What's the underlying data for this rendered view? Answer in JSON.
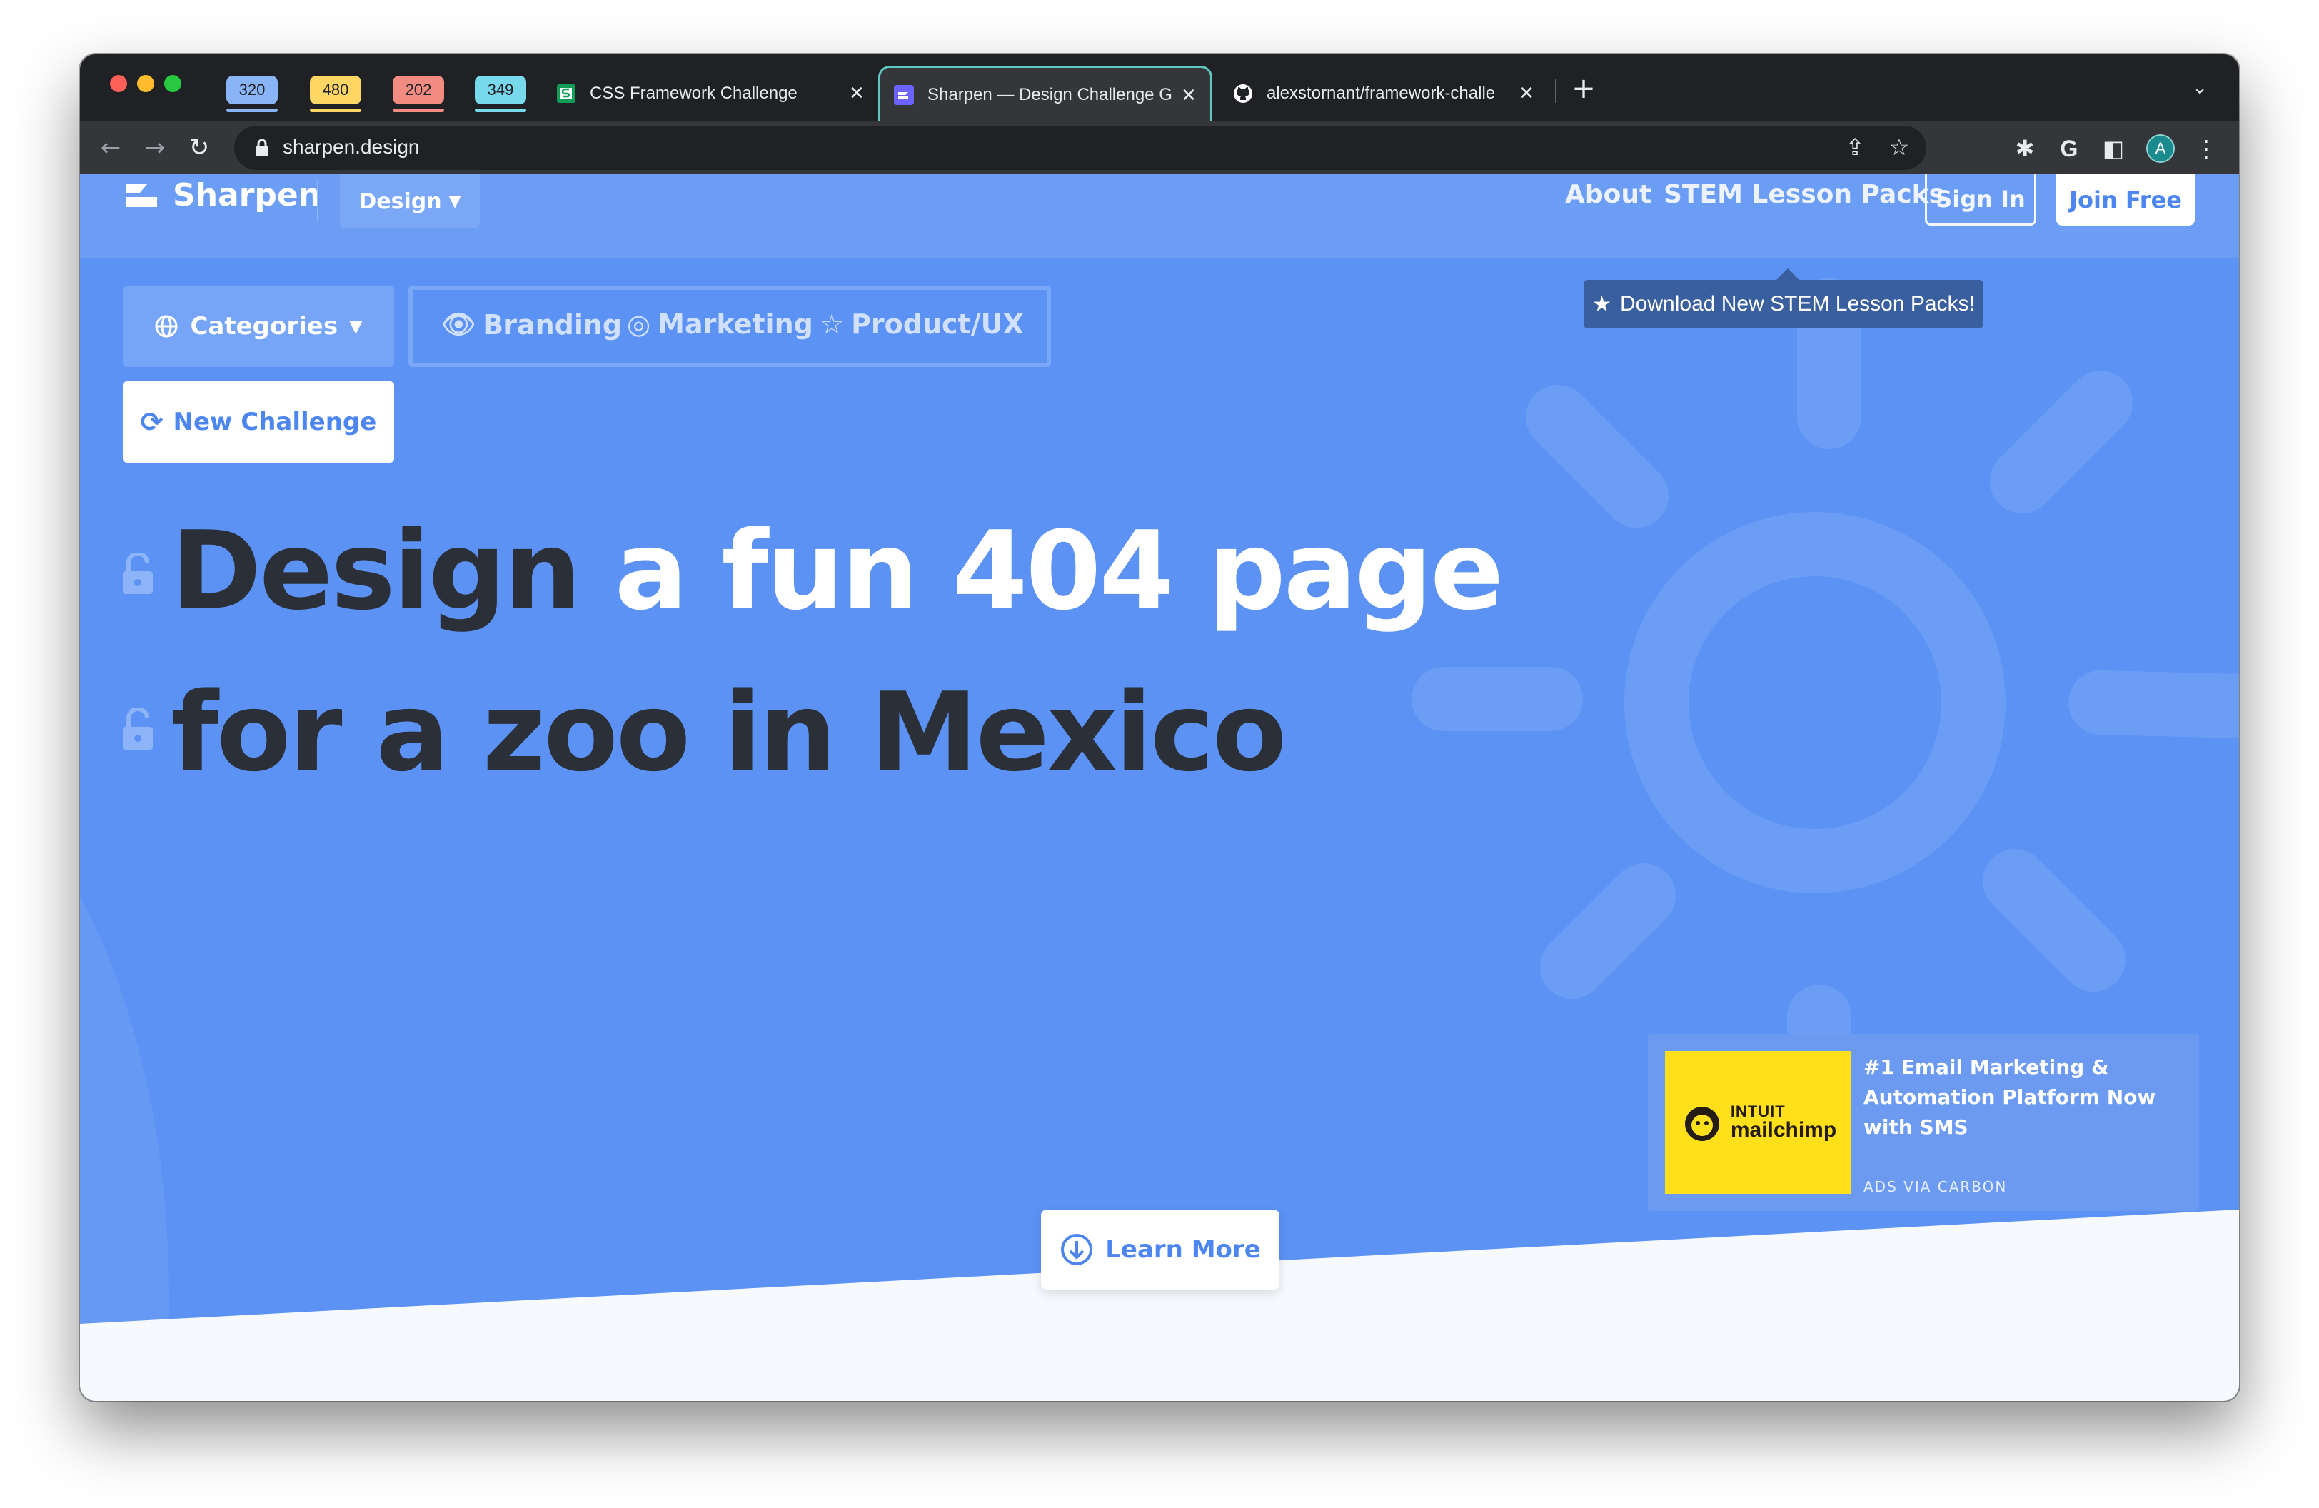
{
  "browser": {
    "tab_groups": [
      {
        "label": "320",
        "color": "#8ab4f8"
      },
      {
        "label": "480",
        "color": "#fdd663"
      },
      {
        "label": "202",
        "color": "#f28b82"
      },
      {
        "label": "349",
        "color": "#78d9ec"
      }
    ],
    "tabs": [
      {
        "title": "CSS Framework Challenge",
        "active": false
      },
      {
        "title": "Sharpen — Design Challenge G",
        "active": true
      },
      {
        "title": "alexstornant/framework-challe",
        "active": false
      }
    ],
    "new_tab_label": "+",
    "url": "sharpen.design",
    "profile_initial": "A"
  },
  "site": {
    "logo_text": "Sharpen",
    "category_dropdown": "Design",
    "nav": {
      "about": "About",
      "stem": "STEM Lesson Packs",
      "signin": "Sign In",
      "joinfree": "Join Free"
    },
    "tooltip": "Download New STEM Lesson Packs!",
    "categories_label": "Categories",
    "category_links": [
      "Branding",
      "Marketing",
      "Product/UX"
    ],
    "new_challenge_label": "New Challenge",
    "headline": {
      "line1_dark": "Design",
      "line1_light": "a fun 404 page",
      "line2": "for a zoo in Mexico"
    },
    "ad": {
      "brand_top": "INTUIT",
      "brand_bottom": "mailchimp",
      "text": "#1 Email Marketing & Automation Platform Now with SMS",
      "via": "ADS VIA CARBON"
    },
    "learn_more_label": "Learn More"
  },
  "colors": {
    "page_blue": "#5b92f4",
    "accent_blue": "#4d86ee",
    "tab_active_outline": "#5fc9c1",
    "ad_yellow": "#ffe01b"
  }
}
